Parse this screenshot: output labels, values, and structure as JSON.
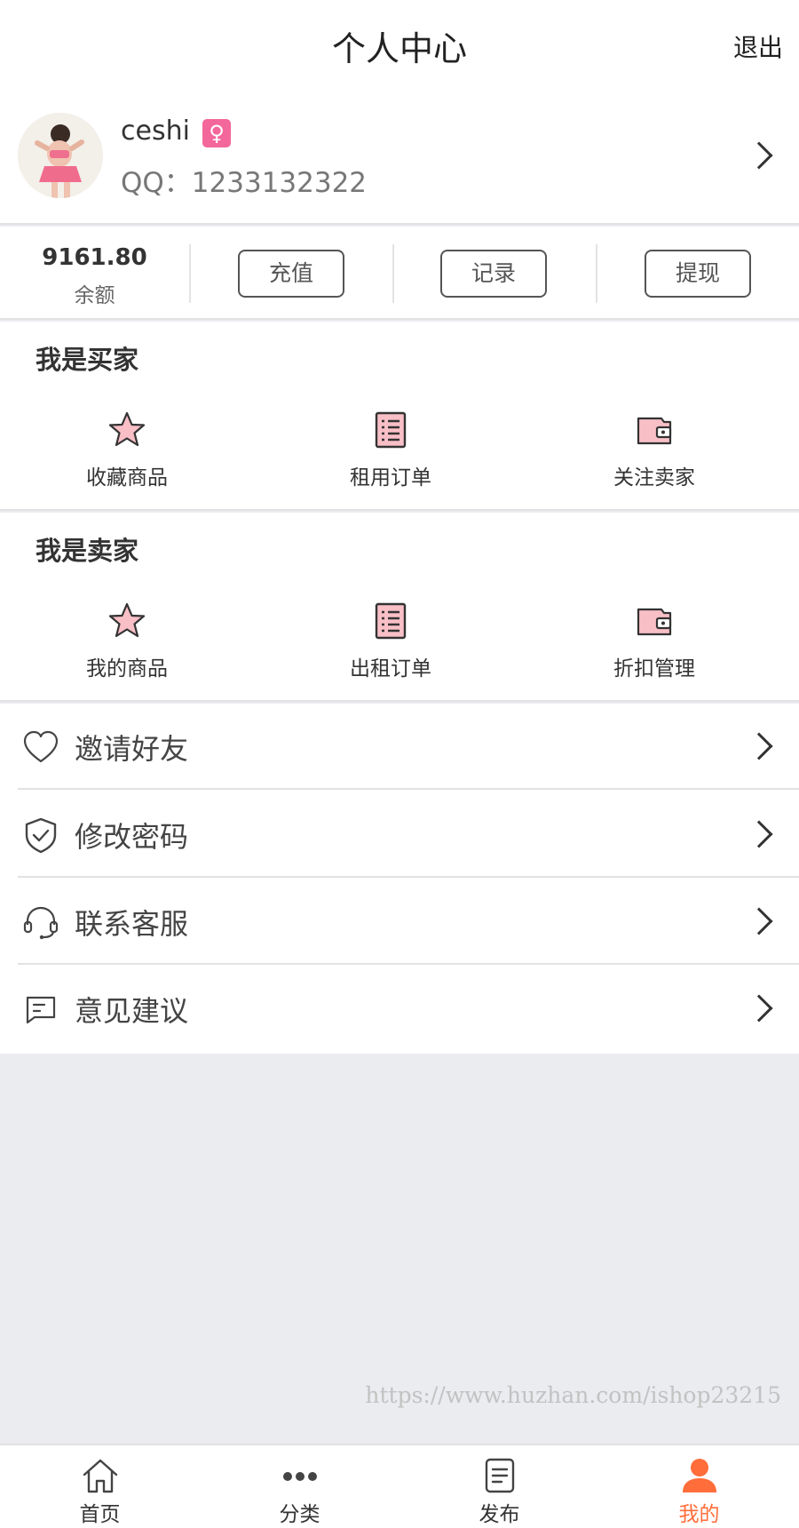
{
  "header": {
    "title": "个人中心",
    "logout_label": "退出"
  },
  "profile": {
    "username": "ceshi",
    "gender_symbol": "♀",
    "qq_label": "QQ：1233132322"
  },
  "balance": {
    "amount": "9161.80",
    "label": "余额",
    "recharge_label": "充值",
    "records_label": "记录",
    "withdraw_label": "提现"
  },
  "buyer": {
    "title": "我是买家",
    "items": [
      {
        "label": "收藏商品",
        "icon": "star-icon"
      },
      {
        "label": "租用订单",
        "icon": "list-icon"
      },
      {
        "label": "关注卖家",
        "icon": "wallet-icon"
      }
    ]
  },
  "seller": {
    "title": "我是卖家",
    "items": [
      {
        "label": "我的商品",
        "icon": "star-icon"
      },
      {
        "label": "出租订单",
        "icon": "list-icon"
      },
      {
        "label": "折扣管理",
        "icon": "wallet-icon"
      }
    ]
  },
  "menu": {
    "items": [
      {
        "label": "邀请好友",
        "icon": "heart-icon"
      },
      {
        "label": "修改密码",
        "icon": "shield-check-icon"
      },
      {
        "label": "联系客服",
        "icon": "headset-icon"
      },
      {
        "label": "意见建议",
        "icon": "message-icon"
      }
    ]
  },
  "watermark": "https://www.huzhan.com/ishop23215",
  "tabbar": {
    "items": [
      {
        "label": "首页",
        "icon": "home-icon"
      },
      {
        "label": "分类",
        "icon": "dots-icon"
      },
      {
        "label": "发布",
        "icon": "document-icon"
      },
      {
        "label": "我的",
        "icon": "user-icon",
        "active": true
      }
    ]
  },
  "colors": {
    "accent": "#ff6d3a",
    "gender_badge": "#f4679a",
    "icon_pink": "#f9bfc7",
    "background": "#ebecf0"
  }
}
